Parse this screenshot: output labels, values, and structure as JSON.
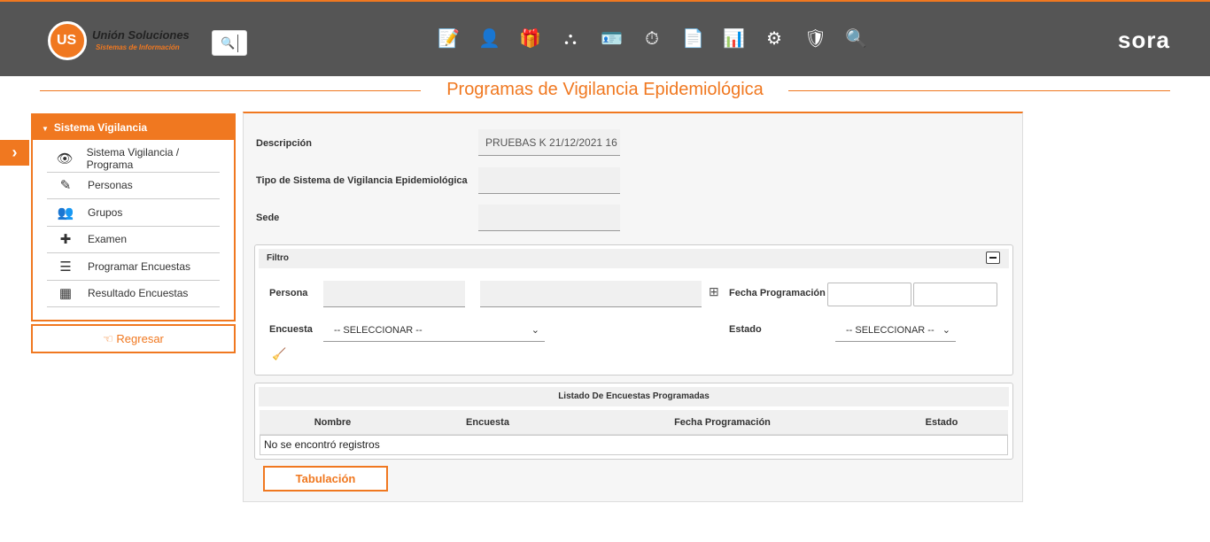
{
  "header": {
    "logo_name": "Unión Soluciones",
    "logo_sub": "Sistemas de Información",
    "logo_mark": "US",
    "brand": "sora",
    "modules": [
      {
        "icon": "document-edit-icon",
        "glyph": "📝"
      },
      {
        "icon": "user-doctor-icon",
        "glyph": "👤"
      },
      {
        "icon": "gift-icon",
        "glyph": "🎁"
      },
      {
        "icon": "hierarchy-icon",
        "glyph": "⛬"
      },
      {
        "icon": "user-id-icon",
        "glyph": "🪪"
      },
      {
        "icon": "stopwatch-icon",
        "glyph": "⏱"
      },
      {
        "icon": "report-list-icon",
        "glyph": "📄"
      },
      {
        "icon": "presentation-icon",
        "glyph": "📊"
      },
      {
        "icon": "gears-icon",
        "glyph": "⚙"
      },
      {
        "icon": "medkit-shield-icon",
        "glyph": "🛡"
      },
      {
        "icon": "inspection-icon",
        "glyph": "🔍"
      }
    ]
  },
  "page": {
    "title": "Programas de Vigilancia Epidemiológica"
  },
  "sidebar": {
    "title": "Sistema Vigilancia",
    "items": [
      {
        "label": "Sistema Vigilancia / Programa",
        "icon": "eye-icon",
        "glyph": "👁"
      },
      {
        "label": "Personas",
        "icon": "edit-icon",
        "glyph": "✎"
      },
      {
        "label": "Grupos",
        "icon": "users-icon",
        "glyph": "👥"
      },
      {
        "label": "Examen",
        "icon": "medical-cross-icon",
        "glyph": "✚"
      },
      {
        "label": "Programar Encuestas",
        "icon": "list-icon",
        "glyph": "☰"
      },
      {
        "label": "Resultado Encuestas",
        "icon": "grid-icon",
        "glyph": "▦"
      }
    ],
    "back_label": "Regresar"
  },
  "form": {
    "descripcion_label": "Descripción",
    "descripcion_value": "PRUEBAS K 21/12/2021 16",
    "tipo_label": "Tipo de Sistema de Vigilancia Epidemiológica",
    "tipo_value": "",
    "sede_label": "Sede",
    "sede_value": ""
  },
  "filter": {
    "title": "Filtro",
    "persona_label": "Persona",
    "fecha_label": "Fecha Programación",
    "encuesta_label": "Encuesta",
    "encuesta_value": "-- SELECCIONAR --",
    "estado_label": "Estado",
    "estado_value": "-- SELECCIONAR --"
  },
  "table": {
    "title": "Listado De Encuestas Programadas",
    "columns": [
      "Nombre",
      "Encuesta",
      "Fecha Programación",
      "Estado"
    ],
    "empty_message": "No se encontró registros"
  },
  "actions": {
    "tabulacion_label": "Tabulación"
  },
  "colors": {
    "accent": "#f07820",
    "header_bg": "#555555"
  }
}
